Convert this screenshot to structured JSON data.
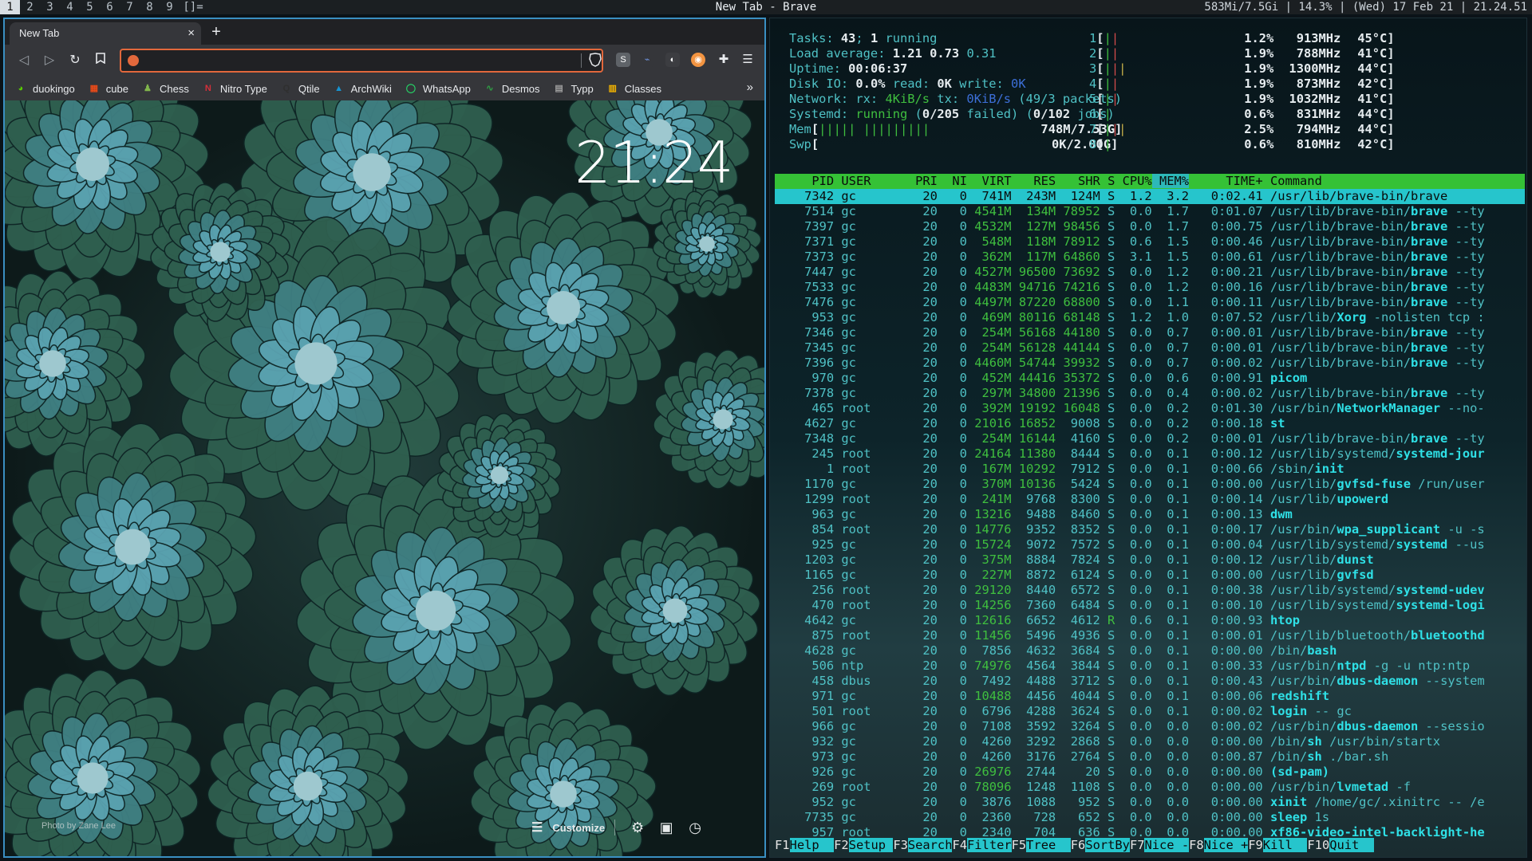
{
  "topbar": {
    "workspaces": [
      "1",
      "2",
      "3",
      "4",
      "5",
      "6",
      "7",
      "8",
      "9"
    ],
    "layout": "[]=",
    "window_title": "New Tab - Brave",
    "status": "583Mi/7.5Gi | 14.3% | (Wed) 17 Feb 21 | 21.24.51"
  },
  "browser": {
    "tab_title": "New Tab",
    "tab_close": "×",
    "new_tab": "+",
    "omnibox_value": "",
    "bookmarks": [
      {
        "label": "duokingo",
        "icon": "duolingo-icon",
        "color": "#58cc02"
      },
      {
        "label": "cube",
        "icon": "cube-icon",
        "color": "#e64a19"
      },
      {
        "label": "Chess",
        "icon": "chess-pawn-icon",
        "color": "#81b64c"
      },
      {
        "label": "Nitro Type",
        "icon": "nitro-type-icon",
        "color": "#d62f3a"
      },
      {
        "label": "Qtile",
        "icon": "qtile-icon",
        "color": "#2f2f2f"
      },
      {
        "label": "ArchWiki",
        "icon": "arch-icon",
        "color": "#1793d1"
      },
      {
        "label": "WhatsApp",
        "icon": "whatsapp-icon",
        "color": "#25d366"
      },
      {
        "label": "Desmos",
        "icon": "desmos-icon",
        "color": "#2f9e44"
      },
      {
        "label": "Typp",
        "icon": "typp-icon",
        "color": "#9e9e9e"
      },
      {
        "label": "Classes",
        "icon": "classes-icon",
        "color": "#f4b400"
      }
    ],
    "bookmarks_more": "»",
    "ntp": {
      "clock": "21:24",
      "photo_credit": "Photo by Zane Lee",
      "customize_label": "Customize"
    }
  },
  "htop": {
    "cpus": [
      {
        "n": "1",
        "bar": "||",
        "pct": "1.2%",
        "freq": "913MHz",
        "temp": "45°C"
      },
      {
        "n": "2",
        "bar": "||",
        "pct": "1.9%",
        "freq": "788MHz",
        "temp": "41°C"
      },
      {
        "n": "3",
        "bar": "|||",
        "pct": "1.9%",
        "freq": "1300MHz",
        "temp": "44°C"
      },
      {
        "n": "4",
        "bar": "||",
        "pct": "1.9%",
        "freq": "873MHz",
        "temp": "42°C"
      },
      {
        "n": "5",
        "bar": "||",
        "pct": "1.9%",
        "freq": "1032MHz",
        "temp": "41°C"
      },
      {
        "n": "6",
        "bar": "|",
        "pct": "0.6%",
        "freq": "831MHz",
        "temp": "44°C"
      },
      {
        "n": "7",
        "bar": "|||",
        "pct": "2.5%",
        "freq": "794MHz",
        "temp": "44°C"
      },
      {
        "n": "8",
        "bar": "|",
        "pct": "0.6%",
        "freq": "810MHz",
        "temp": "42°C"
      }
    ],
    "tasks_label": "Tasks: ",
    "tasks": "43",
    "tasks_running": "1",
    "running_label": " running",
    "load_label": "Load average: ",
    "load1": "1.21",
    "load5": "0.73",
    "load15": "0.31",
    "uptime_label": "Uptime: ",
    "uptime": "00:06:37",
    "diskio_label": "Disk IO: ",
    "diskio_pct": "0.0%",
    "diskio_read_label": " read: ",
    "diskio_read": "0K",
    "diskio_write_label": " write: ",
    "diskio_write": "0K",
    "net_label": "Network: rx: ",
    "net_rx": "4KiB/s",
    "net_tx_label": " tx: ",
    "net_tx": "0KiB/s",
    "net_packets": " (49/3 packets)",
    "systemd_label": "Systemd: ",
    "systemd_state": "running",
    "systemd_failed_pre": " (",
    "systemd_failed": "0/205",
    "systemd_failed_post": " failed) (",
    "systemd_jobs": "0/102",
    "systemd_jobs_post": " jobs)",
    "mem_label": "Mem",
    "mem_bar": "||||| |||||||||",
    "mem_value": "748M/7.53G",
    "swp_label": "Swp",
    "swp_value": "0K/2.00G",
    "header": {
      "pid": "PID",
      "user": "USER",
      "pri": "PRI",
      "ni": "NI",
      "virt": "VIRT",
      "res": "RES",
      "shr": "SHR",
      "s": "S",
      "cpu": "CPU%",
      "mem": "MEM%",
      "time": "TIME+",
      "cmd": "Command"
    },
    "processes": [
      [
        "7342",
        "gc",
        "20",
        "0",
        "741M",
        "243M",
        "124M",
        "S",
        "1.2",
        "3.2",
        "0:02.41",
        "/usr/lib/brave-bin/brave"
      ],
      [
        "7514",
        "gc",
        "20",
        "0",
        "4541M",
        "134M",
        "78952",
        "S",
        "0.0",
        "1.7",
        "0:01.07",
        "/usr/lib/brave-bin/brave --ty"
      ],
      [
        "7397",
        "gc",
        "20",
        "0",
        "4532M",
        "127M",
        "98456",
        "S",
        "0.0",
        "1.7",
        "0:00.75",
        "/usr/lib/brave-bin/brave --ty"
      ],
      [
        "7371",
        "gc",
        "20",
        "0",
        "548M",
        "118M",
        "78912",
        "S",
        "0.6",
        "1.5",
        "0:00.46",
        "/usr/lib/brave-bin/brave --ty"
      ],
      [
        "7373",
        "gc",
        "20",
        "0",
        "362M",
        "117M",
        "64860",
        "S",
        "3.1",
        "1.5",
        "0:00.61",
        "/usr/lib/brave-bin/brave --ty"
      ],
      [
        "7447",
        "gc",
        "20",
        "0",
        "4527M",
        "96500",
        "73692",
        "S",
        "0.0",
        "1.2",
        "0:00.21",
        "/usr/lib/brave-bin/brave --ty"
      ],
      [
        "7533",
        "gc",
        "20",
        "0",
        "4483M",
        "94716",
        "74216",
        "S",
        "0.0",
        "1.2",
        "0:00.16",
        "/usr/lib/brave-bin/brave --ty"
      ],
      [
        "7476",
        "gc",
        "20",
        "0",
        "4497M",
        "87220",
        "68800",
        "S",
        "0.0",
        "1.1",
        "0:00.11",
        "/usr/lib/brave-bin/brave --ty"
      ],
      [
        "953",
        "gc",
        "20",
        "0",
        "469M",
        "80116",
        "68148",
        "S",
        "1.2",
        "1.0",
        "0:07.52",
        "/usr/lib/Xorg -nolisten tcp :"
      ],
      [
        "7346",
        "gc",
        "20",
        "0",
        "254M",
        "56168",
        "44180",
        "S",
        "0.0",
        "0.7",
        "0:00.01",
        "/usr/lib/brave-bin/brave --ty"
      ],
      [
        "7345",
        "gc",
        "20",
        "0",
        "254M",
        "56128",
        "44144",
        "S",
        "0.0",
        "0.7",
        "0:00.01",
        "/usr/lib/brave-bin/brave --ty"
      ],
      [
        "7396",
        "gc",
        "20",
        "0",
        "4460M",
        "54744",
        "39932",
        "S",
        "0.0",
        "0.7",
        "0:00.02",
        "/usr/lib/brave-bin/brave --ty"
      ],
      [
        "970",
        "gc",
        "20",
        "0",
        "452M",
        "44416",
        "35372",
        "S",
        "0.0",
        "0.6",
        "0:00.91",
        "picom"
      ],
      [
        "7378",
        "gc",
        "20",
        "0",
        "297M",
        "34800",
        "21396",
        "S",
        "0.0",
        "0.4",
        "0:00.02",
        "/usr/lib/brave-bin/brave --ty"
      ],
      [
        "465",
        "root",
        "20",
        "0",
        "392M",
        "19192",
        "16048",
        "S",
        "0.0",
        "0.2",
        "0:01.30",
        "/usr/bin/NetworkManager --no-"
      ],
      [
        "4627",
        "gc",
        "20",
        "0",
        "21016",
        "16852",
        "9008",
        "S",
        "0.0",
        "0.2",
        "0:00.18",
        "st"
      ],
      [
        "7348",
        "gc",
        "20",
        "0",
        "254M",
        "16144",
        "4160",
        "S",
        "0.0",
        "0.2",
        "0:00.01",
        "/usr/lib/brave-bin/brave --ty"
      ],
      [
        "245",
        "root",
        "20",
        "0",
        "24164",
        "11380",
        "8444",
        "S",
        "0.0",
        "0.1",
        "0:00.12",
        "/usr/lib/systemd/systemd-jour"
      ],
      [
        "1",
        "root",
        "20",
        "0",
        "167M",
        "10292",
        "7912",
        "S",
        "0.0",
        "0.1",
        "0:00.66",
        "/sbin/init"
      ],
      [
        "1170",
        "gc",
        "20",
        "0",
        "370M",
        "10136",
        "5424",
        "S",
        "0.0",
        "0.1",
        "0:00.00",
        "/usr/lib/gvfsd-fuse /run/user"
      ],
      [
        "1299",
        "root",
        "20",
        "0",
        "241M",
        "9768",
        "8300",
        "S",
        "0.0",
        "0.1",
        "0:00.14",
        "/usr/lib/upowerd"
      ],
      [
        "963",
        "gc",
        "20",
        "0",
        "13216",
        "9488",
        "8460",
        "S",
        "0.0",
        "0.1",
        "0:00.13",
        "dwm"
      ],
      [
        "854",
        "root",
        "20",
        "0",
        "14776",
        "9352",
        "8352",
        "S",
        "0.0",
        "0.1",
        "0:00.17",
        "/usr/bin/wpa_supplicant -u -s"
      ],
      [
        "925",
        "gc",
        "20",
        "0",
        "15724",
        "9072",
        "7572",
        "S",
        "0.0",
        "0.1",
        "0:00.04",
        "/usr/lib/systemd/systemd --us"
      ],
      [
        "1203",
        "gc",
        "20",
        "0",
        "375M",
        "8884",
        "7824",
        "S",
        "0.0",
        "0.1",
        "0:00.12",
        "/usr/lib/dunst"
      ],
      [
        "1165",
        "gc",
        "20",
        "0",
        "227M",
        "8872",
        "6124",
        "S",
        "0.0",
        "0.1",
        "0:00.00",
        "/usr/lib/gvfsd"
      ],
      [
        "256",
        "root",
        "20",
        "0",
        "29120",
        "8440",
        "6572",
        "S",
        "0.0",
        "0.1",
        "0:00.38",
        "/usr/lib/systemd/systemd-udev"
      ],
      [
        "470",
        "root",
        "20",
        "0",
        "14256",
        "7360",
        "6484",
        "S",
        "0.0",
        "0.1",
        "0:00.10",
        "/usr/lib/systemd/systemd-logi"
      ],
      [
        "4642",
        "gc",
        "20",
        "0",
        "12616",
        "6652",
        "4612",
        "R",
        "0.6",
        "0.1",
        "0:00.93",
        "htop"
      ],
      [
        "875",
        "root",
        "20",
        "0",
        "11456",
        "5496",
        "4936",
        "S",
        "0.0",
        "0.1",
        "0:00.01",
        "/usr/lib/bluetooth/bluetoothd"
      ],
      [
        "4628",
        "gc",
        "20",
        "0",
        "7856",
        "4632",
        "3684",
        "S",
        "0.0",
        "0.1",
        "0:00.00",
        "/bin/bash"
      ],
      [
        "506",
        "ntp",
        "20",
        "0",
        "74976",
        "4564",
        "3844",
        "S",
        "0.0",
        "0.1",
        "0:00.33",
        "/usr/bin/ntpd -g -u ntp:ntp"
      ],
      [
        "458",
        "dbus",
        "20",
        "0",
        "7492",
        "4488",
        "3712",
        "S",
        "0.0",
        "0.1",
        "0:00.43",
        "/usr/bin/dbus-daemon --system"
      ],
      [
        "971",
        "gc",
        "20",
        "0",
        "10488",
        "4456",
        "4044",
        "S",
        "0.0",
        "0.1",
        "0:00.06",
        "redshift"
      ],
      [
        "501",
        "root",
        "20",
        "0",
        "6796",
        "4288",
        "3624",
        "S",
        "0.0",
        "0.1",
        "0:00.02",
        "login -- gc"
      ],
      [
        "966",
        "gc",
        "20",
        "0",
        "7108",
        "3592",
        "3264",
        "S",
        "0.0",
        "0.0",
        "0:00.02",
        "/usr/bin/dbus-daemon --sessio"
      ],
      [
        "932",
        "gc",
        "20",
        "0",
        "4260",
        "3292",
        "2868",
        "S",
        "0.0",
        "0.0",
        "0:00.00",
        "/bin/sh /usr/bin/startx"
      ],
      [
        "973",
        "gc",
        "20",
        "0",
        "4260",
        "3176",
        "2764",
        "S",
        "0.0",
        "0.0",
        "0:00.87",
        "/bin/sh ./bar.sh"
      ],
      [
        "926",
        "gc",
        "20",
        "0",
        "26976",
        "2744",
        "20",
        "S",
        "0.0",
        "0.0",
        "0:00.00",
        "(sd-pam)"
      ],
      [
        "269",
        "root",
        "20",
        "0",
        "78096",
        "1248",
        "1108",
        "S",
        "0.0",
        "0.0",
        "0:00.00",
        "/usr/bin/lvmetad -f"
      ],
      [
        "952",
        "gc",
        "20",
        "0",
        "3876",
        "1088",
        "952",
        "S",
        "0.0",
        "0.0",
        "0:00.00",
        "xinit /home/gc/.xinitrc -- /e"
      ],
      [
        "7735",
        "gc",
        "20",
        "0",
        "2360",
        "728",
        "652",
        "S",
        "0.0",
        "0.0",
        "0:00.00",
        "sleep 1s"
      ],
      [
        "957",
        "root",
        "20",
        "0",
        "2340",
        "704",
        "636",
        "S",
        "0.0",
        "0.0",
        "0:00.00",
        "xf86-video-intel-backlight-he"
      ]
    ],
    "fkeys": [
      {
        "k": "F1",
        "l": "Help  "
      },
      {
        "k": "F2",
        "l": "Setup "
      },
      {
        "k": "F3",
        "l": "Search"
      },
      {
        "k": "F4",
        "l": "Filter"
      },
      {
        "k": "F5",
        "l": "Tree  "
      },
      {
        "k": "F6",
        "l": "SortBy"
      },
      {
        "k": "F7",
        "l": "Nice -"
      },
      {
        "k": "F8",
        "l": "Nice +"
      },
      {
        "k": "F9",
        "l": "Kill  "
      },
      {
        "k": "F10",
        "l": "Quit  "
      }
    ]
  }
}
